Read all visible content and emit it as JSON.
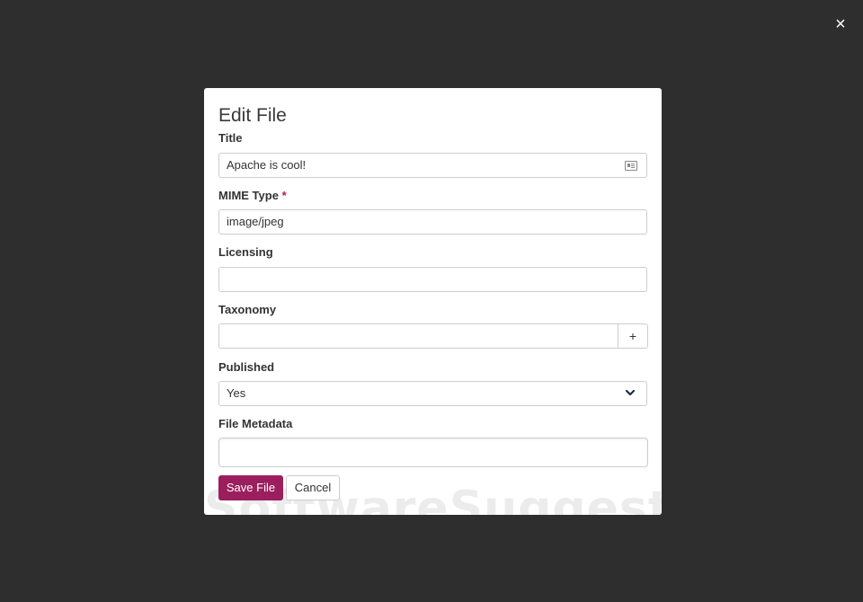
{
  "overlay": {
    "close_icon": "×"
  },
  "modal": {
    "title": "Edit File",
    "watermark": "SoftwareSuggest",
    "fields": {
      "title": {
        "label": "Title",
        "value": "Apache is cool!"
      },
      "mime_type": {
        "label": "MIME Type",
        "required_mark": "*",
        "value": "image/jpeg"
      },
      "licensing": {
        "label": "Licensing",
        "value": ""
      },
      "taxonomy": {
        "label": "Taxonomy",
        "value": "",
        "add_icon": "+"
      },
      "published": {
        "label": "Published",
        "selected": "Yes"
      },
      "file_metadata": {
        "label": "File Metadata",
        "value": ""
      }
    },
    "buttons": {
      "save": "Save File",
      "cancel": "Cancel"
    }
  },
  "colors": {
    "backdrop": "#2e2e2e",
    "primary_button": "#9b1f5e",
    "required": "#b81e3a"
  }
}
